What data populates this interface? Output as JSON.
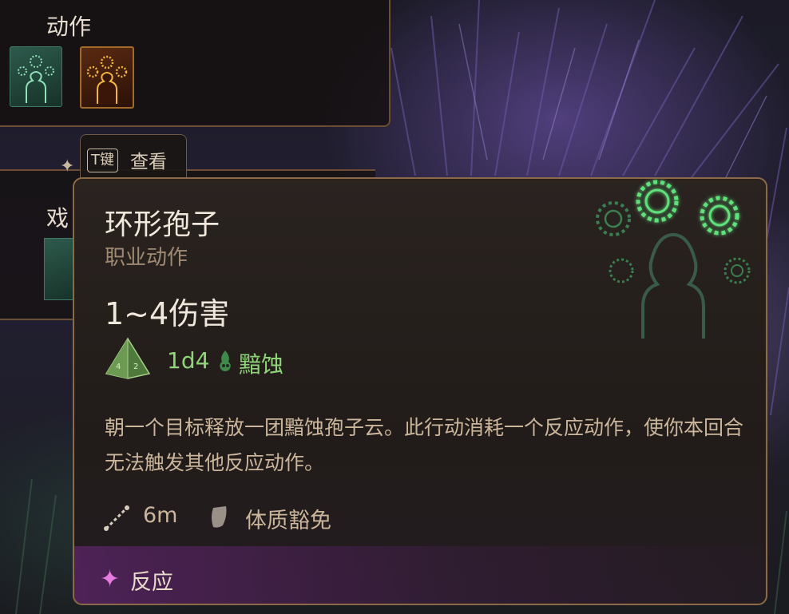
{
  "actions_panel": {
    "title": "动作",
    "icons": [
      "circle-spores-icon",
      "golden-spores-icon"
    ]
  },
  "second_panel": {
    "title_partial": "戏"
  },
  "t_key_tab": {
    "key": "T键",
    "label": "查看"
  },
  "tooltip": {
    "title": "环形孢子",
    "subtitle": "职业动作",
    "damage": "1~4伤害",
    "dice": "1d4",
    "damage_type": "黯蚀",
    "description": "朝一个目标释放一团黯蚀孢子云。此行动消耗一个反应动作，使你本回合无法触发其他反应动作。",
    "range": "6m",
    "saving_throw": "体质豁免",
    "action_cost": "反应"
  },
  "colors": {
    "accent_green": "#8fd47a",
    "border_bronze": "#8a6a4a",
    "reaction_pink": "#e47de0"
  }
}
